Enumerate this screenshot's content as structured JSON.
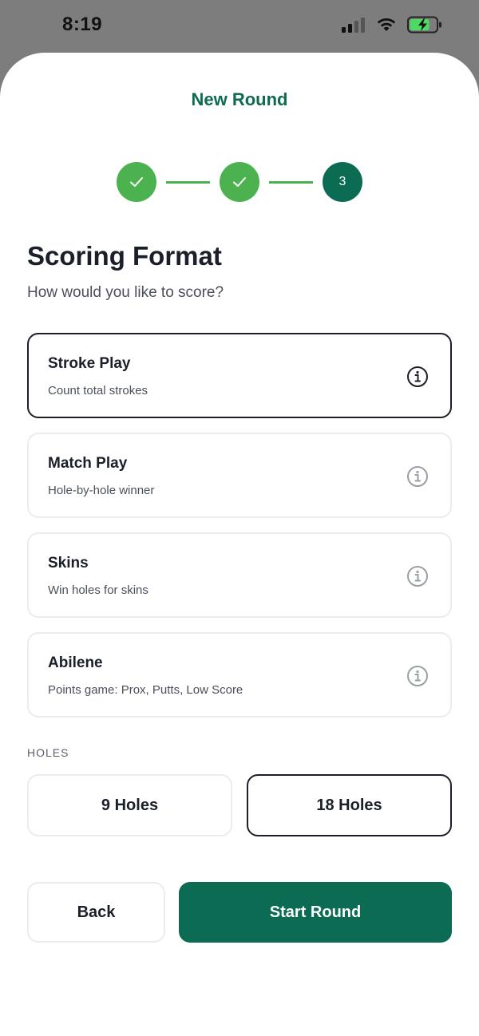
{
  "status_bar": {
    "time": "8:19"
  },
  "sheet": {
    "title": "New Round"
  },
  "stepper": {
    "current_step_label": "3"
  },
  "section": {
    "title": "Scoring Format",
    "subtitle": "How would you like to score?"
  },
  "formats": [
    {
      "title": "Stroke Play",
      "description": "Count total strokes",
      "selected": true
    },
    {
      "title": "Match Play",
      "description": "Hole-by-hole winner",
      "selected": false
    },
    {
      "title": "Skins",
      "description": "Win holes for skins",
      "selected": false
    },
    {
      "title": "Abilene",
      "description": "Points game: Prox, Putts, Low Score",
      "selected": false
    }
  ],
  "holes": {
    "label": "HOLES",
    "options": [
      "9 Holes",
      "18 Holes"
    ],
    "selected": "18 Holes"
  },
  "actions": {
    "back_label": "Back",
    "start_label": "Start Round"
  },
  "colors": {
    "brand_green": "#0b6b53",
    "step_done_green": "#4cb24f",
    "title_green": "#0e6b51",
    "battery_green": "#4cd964"
  }
}
